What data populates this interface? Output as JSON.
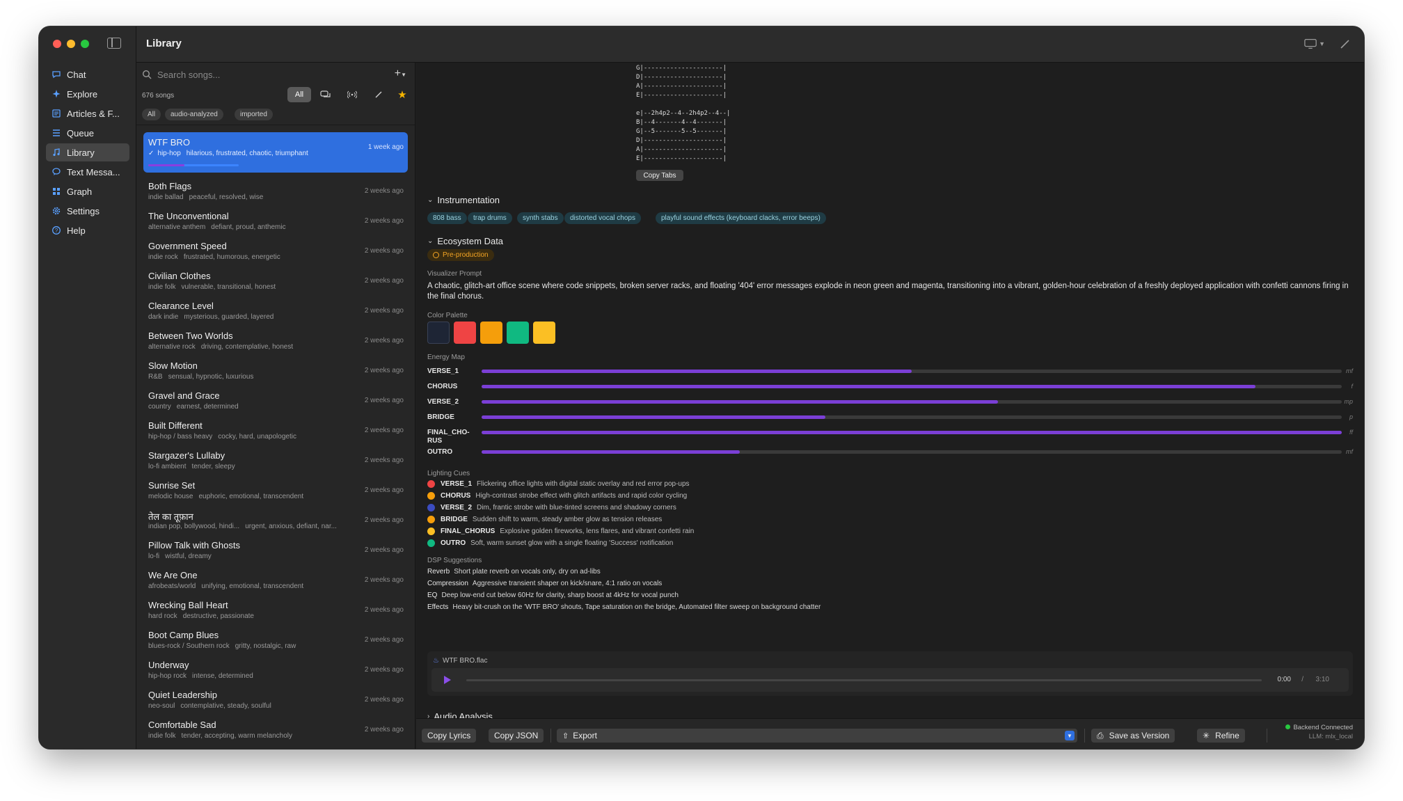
{
  "window": {
    "title": "Library"
  },
  "sidebar": {
    "items": [
      {
        "label": "Chat",
        "icon": "chat-bubble-icon"
      },
      {
        "label": "Explore",
        "icon": "sparkles-icon"
      },
      {
        "label": "Articles & F...",
        "icon": "newspaper-icon"
      },
      {
        "label": "Queue",
        "icon": "list-icon"
      },
      {
        "label": "Library",
        "icon": "music-notes-icon",
        "active": true
      },
      {
        "label": "Text Messa...",
        "icon": "message-icon"
      },
      {
        "label": "Graph",
        "icon": "grid-graph-icon"
      },
      {
        "label": "Settings",
        "icon": "gear-icon"
      },
      {
        "label": "Help",
        "icon": "question-circle-icon"
      }
    ]
  },
  "list": {
    "search_placeholder": "Search songs...",
    "count": "676 songs",
    "filter_all": "All",
    "chips": [
      "All",
      "audio-analyzed",
      "imported"
    ],
    "songs": [
      {
        "title": "WTF BRO",
        "genre": "hip-hop",
        "moods": "hilarious, frustrated, chaotic, triumphant",
        "date": "1 week ago",
        "selected": true
      },
      {
        "title": "Both Flags",
        "genre": "indie ballad",
        "moods": "peaceful, resolved, wise",
        "date": "2 weeks ago"
      },
      {
        "title": "The Unconventional",
        "genre": "alternative anthem",
        "moods": "defiant, proud, anthemic",
        "date": "2 weeks ago"
      },
      {
        "title": "Government Speed",
        "genre": "indie rock",
        "moods": "frustrated, humorous, energetic",
        "date": "2 weeks ago"
      },
      {
        "title": "Civilian Clothes",
        "genre": "indie folk",
        "moods": "vulnerable, transitional, honest",
        "date": "2 weeks ago"
      },
      {
        "title": "Clearance Level",
        "genre": "dark indie",
        "moods": "mysterious, guarded, layered",
        "date": "2 weeks ago"
      },
      {
        "title": "Between Two Worlds",
        "genre": "alternative rock",
        "moods": "driving, contemplative, honest",
        "date": "2 weeks ago"
      },
      {
        "title": "Slow Motion",
        "genre": "R&B",
        "moods": "sensual, hypnotic, luxurious",
        "date": "2 weeks ago"
      },
      {
        "title": "Gravel and Grace",
        "genre": "country",
        "moods": "earnest, determined",
        "date": "2 weeks ago"
      },
      {
        "title": "Built Different",
        "genre": "hip-hop / bass heavy",
        "moods": "cocky, hard, unapologetic",
        "date": "2 weeks ago"
      },
      {
        "title": "Stargazer's Lullaby",
        "genre": "lo-fi ambient",
        "moods": "tender, sleepy",
        "date": "2 weeks ago"
      },
      {
        "title": "Sunrise Set",
        "genre": "melodic house",
        "moods": "euphoric, emotional, transcendent",
        "date": "2 weeks ago"
      },
      {
        "title": "तेल का तूफ़ान",
        "genre": "indian pop, bollywood, hindi...",
        "moods": "urgent, anxious, defiant, nar...",
        "date": "2 weeks ago"
      },
      {
        "title": "Pillow Talk with Ghosts",
        "genre": "lo-fi",
        "moods": "wistful, dreamy",
        "date": "2 weeks ago"
      },
      {
        "title": "We Are One",
        "genre": "afrobeats/world",
        "moods": "unifying, emotional, transcendent",
        "date": "2 weeks ago"
      },
      {
        "title": "Wrecking Ball Heart",
        "genre": "hard rock",
        "moods": "destructive, passionate",
        "date": "2 weeks ago"
      },
      {
        "title": "Boot Camp Blues",
        "genre": "blues-rock / Southern rock",
        "moods": "gritty, nostalgic, raw",
        "date": "2 weeks ago"
      },
      {
        "title": "Underway",
        "genre": "hip-hop rock",
        "moods": "intense, determined",
        "date": "2 weeks ago"
      },
      {
        "title": "Quiet Leadership",
        "genre": "neo-soul",
        "moods": "contemplative, steady, soulful",
        "date": "2 weeks ago"
      },
      {
        "title": "Comfortable Sad",
        "genre": "indie folk",
        "moods": "tender, accepting, warm melancholy",
        "date": "2 weeks ago"
      }
    ]
  },
  "detail": {
    "tabs_block_1": "G|---------------------|\nD|---------------------|\nA|---------------------|\nE|---------------------|",
    "tabs_block_2": "e|--2h4p2--4--2h4p2--4--|\nB|--4-------4--4-------|\nG|--5-------5--5-------|\nD|---------------------|\nA|---------------------|\nE|---------------------|",
    "copy_tabs": "Copy Tabs",
    "instrumentation_title": "Instrumentation",
    "instruments": [
      "808 bass",
      "trap drums",
      "synth stabs",
      "distorted vocal chops",
      "playful sound effects (keyboard clacks, error beeps)"
    ],
    "ecosystem_title": "Ecosystem Data",
    "status_badge": "Pre-production",
    "visualizer_label": "Visualizer Prompt",
    "visualizer_text": "A chaotic, glitch-art office scene where code snippets, broken server racks, and floating '404' error messages explode in neon green and magenta, transitioning into a vibrant, golden-hour celebration of a freshly deployed application with confetti cannons firing in the final chorus.",
    "palette_label": "Color Palette",
    "palette": [
      "#1e2535",
      "#ef4444",
      "#f59e0b",
      "#10b981",
      "#fbbf24"
    ],
    "energy_label": "Energy Map",
    "energy": [
      {
        "section": "VERSE_1",
        "level": 0.5,
        "dynamic": "mf"
      },
      {
        "section": "CHORUS",
        "level": 0.9,
        "dynamic": "f"
      },
      {
        "section": "VERSE_2",
        "level": 0.6,
        "dynamic": "mp"
      },
      {
        "section": "BRIDGE",
        "level": 0.4,
        "dynamic": "p"
      },
      {
        "section": "FINAL_CHO-RUS",
        "level": 1.0,
        "dynamic": "ff"
      },
      {
        "section": "OUTRO",
        "level": 0.3,
        "dynamic": "mf"
      }
    ],
    "lighting_label": "Lighting Cues",
    "lighting": [
      {
        "section": "VERSE_1",
        "text": "Flickering office lights with digital static overlay and red error pop-ups",
        "color": "#ef4444"
      },
      {
        "section": "CHORUS",
        "text": "High-contrast strobe effect with glitch artifacts and rapid color cycling",
        "color": "#f59e0b"
      },
      {
        "section": "VERSE_2",
        "text": "Dim, frantic strobe with blue-tinted screens and shadowy corners",
        "color": "#3b4cc0"
      },
      {
        "section": "BRIDGE",
        "text": "Sudden shift to warm, steady amber glow as tension releases",
        "color": "#f59e0b"
      },
      {
        "section": "FINAL_CHORUS",
        "text": "Explosive golden fireworks, lens flares, and vibrant confetti rain",
        "color": "#fbbf24"
      },
      {
        "section": "OUTRO",
        "text": "Soft, warm sunset glow with a single floating 'Success' notification",
        "color": "#10b981"
      }
    ],
    "dsp_label": "DSP Suggestions",
    "dsp": [
      {
        "name": "Reverb",
        "text": "Short plate reverb on vocals only, dry on ad-libs"
      },
      {
        "name": "Compression",
        "text": "Aggressive transient shaper on kick/snare, 4:1 ratio on vocals"
      },
      {
        "name": "EQ",
        "text": "Deep low-end cut below 60Hz for clarity, sharp boost at 4kHz for vocal punch"
      },
      {
        "name": "Effects",
        "text": "Heavy bit-crush on the 'WTF BRO' shouts, Tape saturation on the bridge, Automated filter sweep on background chatter"
      }
    ],
    "player": {
      "file": "WTF BRO.flac",
      "current": "0:00",
      "sep": "/",
      "duration": "3:10",
      "progress": 0
    },
    "audio_analysis_title": "Audio Analysis"
  },
  "footer": {
    "copy_lyrics": "Copy Lyrics",
    "copy_json": "Copy JSON",
    "export": "Export",
    "save_version": "Save as Version",
    "refine": "Refine",
    "backend_status": "Backend Connected",
    "llm": "LLM: mlx_local"
  }
}
